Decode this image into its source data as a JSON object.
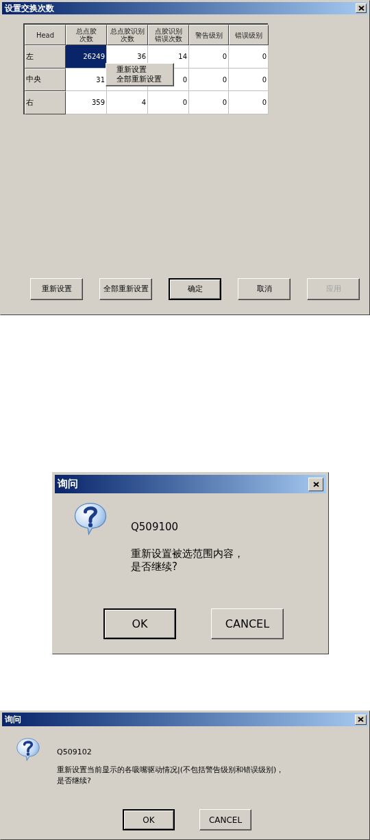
{
  "windows": [
    {
      "kind": "table_dialog",
      "title": "设置交换次数",
      "table": {
        "columns": [
          "Head",
          "总点胶次数",
          "总点胶识别次数",
          "点胶识别错误次数",
          "警告级别",
          "错误级别"
        ],
        "rows": [
          {
            "cells": [
              {
                "kind": "row_header",
                "text": "左"
              },
              {
                "text": "26249",
                "selected": true
              },
              {
                "text": "36",
                "selected": false
              },
              {
                "text": "14",
                "selected": false
              },
              {
                "text": "0",
                "selected": false
              },
              {
                "text": "0",
                "selected": false
              }
            ]
          },
          {
            "cells": [
              {
                "kind": "row_header",
                "text": "中央"
              },
              {
                "text": "31",
                "selected": false
              },
              null,
              {
                "text": "0",
                "selected": false
              },
              {
                "text": "0",
                "selected": false
              },
              {
                "text": "0",
                "selected": false
              }
            ]
          },
          {
            "cells": [
              {
                "kind": "row_header",
                "text": "右"
              },
              {
                "text": "359",
                "selected": false
              },
              {
                "text": "4",
                "selected": false
              },
              {
                "text": "0",
                "selected": false
              },
              {
                "text": "0",
                "selected": false
              },
              {
                "text": "0",
                "selected": false
              }
            ]
          }
        ]
      },
      "context_menu": [
        "重新设置",
        "全部重新设置"
      ],
      "buttons": [
        {
          "label": "重新设置",
          "default": false,
          "disabled": false
        },
        {
          "label": "全部重新设置",
          "default": false,
          "disabled": false
        },
        {
          "label": "确定",
          "default": true,
          "disabled": false
        },
        {
          "label": "取消",
          "default": false,
          "disabled": false
        },
        {
          "label": "应用",
          "default": false,
          "disabled": true
        }
      ]
    },
    {
      "kind": "message_box",
      "title": "询问",
      "code": "Q509100",
      "message": [
        "重新设置被选范围内容，",
        "是否继续?"
      ],
      "buttons": [
        {
          "label": "OK",
          "default": true,
          "disabled": false
        },
        {
          "label": "CANCEL",
          "default": false,
          "disabled": false
        }
      ]
    },
    {
      "kind": "message_box_wide",
      "title": "询问",
      "code": "Q509102",
      "message": [
        "重新设置当前显示的各吸嘴驱动情况|(不包括警告级别和错误级别)，",
        "是否继续?"
      ],
      "buttons": [
        {
          "label": "OK",
          "default": true,
          "disabled": false
        },
        {
          "label": "CANCEL",
          "default": false,
          "disabled": false
        }
      ]
    }
  ]
}
